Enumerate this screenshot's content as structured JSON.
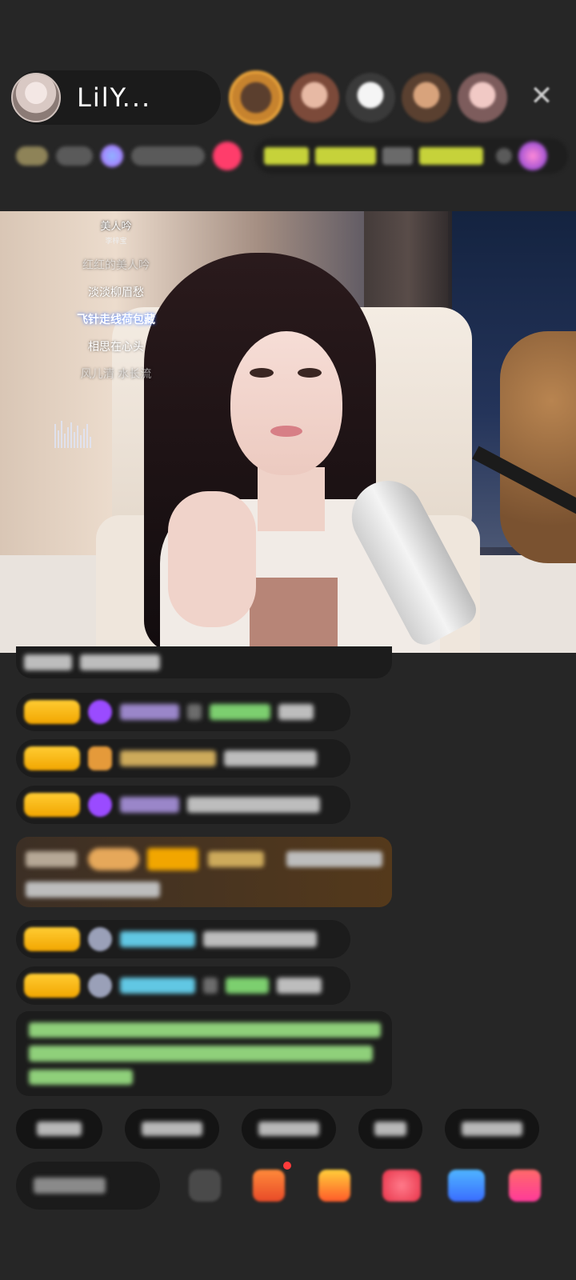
{
  "header": {
    "host_name": "LilY...",
    "viewer_avatars": [
      "viewer-1",
      "viewer-2",
      "viewer-3",
      "viewer-4",
      "viewer-5"
    ],
    "close_icon": "close-icon"
  },
  "stream": {
    "song_title": "美人吟",
    "song_singer": "李梓宝",
    "song_tag": "",
    "lyrics": [
      {
        "text": "红红的美人吟",
        "state": "faded"
      },
      {
        "text": "淡淡柳眉愁",
        "state": "normal"
      },
      {
        "text": "飞针走线荷包藏",
        "state": "active"
      },
      {
        "text": "相思在心头",
        "state": "normal"
      },
      {
        "text": "风儿清 水长流",
        "state": "faded"
      }
    ]
  },
  "colors": {
    "level_badge": "#f2a600",
    "system_text": "#8fd07a",
    "username_blue": "#61c7e3",
    "username_purple": "#9a86c9",
    "gift_bg": "#54391b"
  },
  "icons": [
    "close-icon",
    "diamond-icon",
    "heart-badge-icon",
    "gift-icon",
    "chat-icon",
    "share-icon",
    "more-icon"
  ]
}
